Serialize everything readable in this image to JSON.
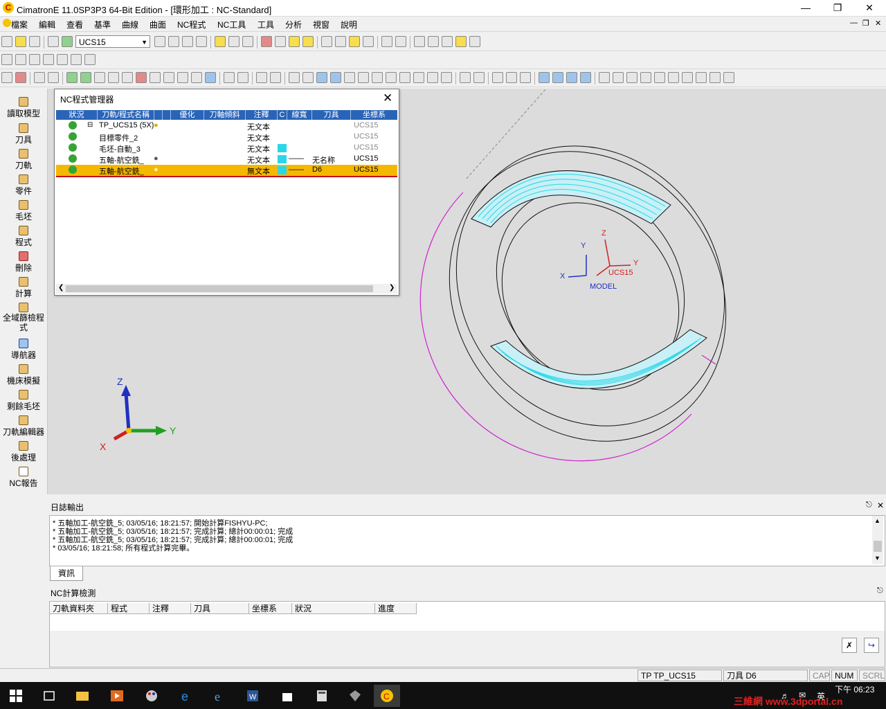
{
  "window": {
    "title": "CimatronE 11.0SP3P3 64-Bit Edition - [環形加工 : NC-Standard]",
    "app_icon": "cimatron-logo-icon",
    "controls": [
      "minimize-icon",
      "restore-icon",
      "close-icon"
    ]
  },
  "menu": [
    "檔案",
    "編輯",
    "查看",
    "基準",
    "曲線",
    "曲面",
    "NC程式",
    "NC工具",
    "工具",
    "分析",
    "視窗",
    "說明"
  ],
  "toolbar": {
    "ucs_combo": "UCS15"
  },
  "left_panel": [
    {
      "label": "讀取模型",
      "icon": "open-model-icon"
    },
    {
      "label": "刀具",
      "icon": "tool-icon"
    },
    {
      "label": "刀軌",
      "icon": "toolpath-icon"
    },
    {
      "label": "零件",
      "icon": "part-icon"
    },
    {
      "label": "毛坯",
      "icon": "stock-icon"
    },
    {
      "label": "程式",
      "icon": "procedure-icon"
    },
    {
      "label": "刪除",
      "icon": "delete-icon"
    },
    {
      "label": "計算",
      "icon": "execute-icon"
    },
    {
      "label": "全域篩檢程式",
      "icon": "global-filter-icon"
    },
    {
      "label": "導航器",
      "icon": "navigator-icon"
    },
    {
      "label": "機床模擬",
      "icon": "machine-sim-icon"
    },
    {
      "label": "剩餘毛坯",
      "icon": "remaining-stock-icon"
    },
    {
      "label": "刀軌編輯器",
      "icon": "toolpath-editor-icon"
    },
    {
      "label": "後處理",
      "icon": "post-process-icon"
    },
    {
      "label": "NC報告",
      "icon": "nc-report-icon"
    }
  ],
  "nc_manager": {
    "title": "NC程式管理器",
    "columns": [
      "狀況",
      "刀軌/程式名稱",
      "",
      "",
      "優化",
      "刀軸傾斜",
      "注釋",
      "C",
      "線寬",
      "刀具",
      "坐標系"
    ],
    "rows": [
      {
        "name": "TP_UCS15 (5X)",
        "comment": "无文本",
        "tool": "",
        "ucs": "UCS15"
      },
      {
        "name": "目標零件_2",
        "comment": "无文本",
        "tool": "",
        "ucs": "UCS15"
      },
      {
        "name": "毛坯-自動_3",
        "comment": "无文本",
        "tool": "",
        "ucs": "UCS15"
      },
      {
        "name": "五軸-航空銑_",
        "comment": "无文本",
        "tool": "无名称",
        "ucs": "UCS15"
      },
      {
        "name": "五軸-航空銑_",
        "comment": "無文本",
        "tool": "D6",
        "ucs": "UCS15"
      }
    ]
  },
  "viewport": {
    "ucs_label": "UCS15",
    "model_label": "MODEL",
    "triad": {
      "x": "X",
      "y": "Y",
      "z": "Z"
    },
    "colors": {
      "background": "#dcdcdc",
      "toolpath": "#2ad7e8",
      "stock_arc": "#d020d0",
      "ucs_red": "#d02020",
      "model_blue": "#2030c0"
    }
  },
  "log": {
    "title": "日誌輸出",
    "lines": [
      "* 五軸加工-航空銑_5; 03/05/16; 18:21:57; 開始計算FISHYU-PC;",
      "* 五軸加工-航空銑_5; 03/05/16; 18:21:57; 完成計算; 總計00:00:01; 完成",
      "* 五軸加工-航空銑_5; 03/05/16; 18:21:57; 完成計算; 總計00:00:01; 完成",
      "* 03/05/16; 18:21:58; 所有程式計算完畢。"
    ],
    "tab": "資訊"
  },
  "nc_calc": {
    "title": "NC計算檢測",
    "columns": [
      "刀軌資料夾",
      "程式",
      "注釋",
      "刀具",
      "坐標系",
      "狀況",
      "進度"
    ]
  },
  "status": {
    "tp": "TP  TP_UCS15",
    "tool": "刀具  D6",
    "cap": "CAP",
    "num": "NUM",
    "scrl": "SCRL"
  },
  "taskbar": {
    "time": "下午 06:23",
    "ime": "英",
    "watermark": "三維網 www.3dportal.cn"
  }
}
